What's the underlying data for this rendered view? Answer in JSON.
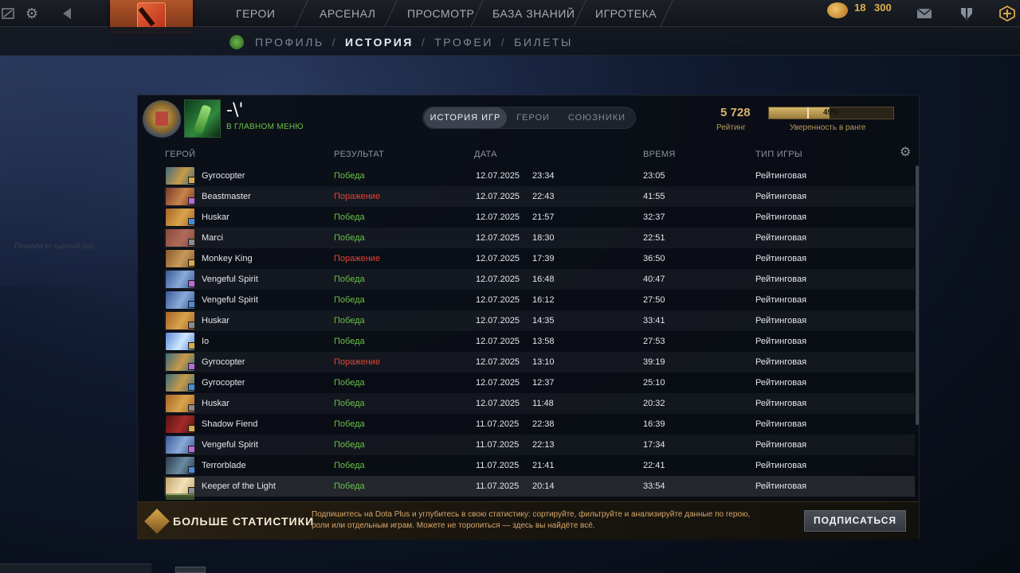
{
  "topbar": {
    "nav": [
      "ГЕРОИ",
      "АРСЕНАЛ",
      "ПРОСМОТР",
      "БАЗА ЗНАНИЙ",
      "ИГРОТЕКА"
    ],
    "currency_a": "18",
    "currency_b": "300"
  },
  "subnav": {
    "items": [
      "ПРОФИЛЬ",
      "ИСТОРИЯ",
      "ТРОФЕИ",
      "БИЛЕТЫ"
    ],
    "separator": "/",
    "active": "ИСТОРИЯ"
  },
  "profile": {
    "name": "-\\'",
    "status": "В ГЛАВНОМ МЕНЮ",
    "rating_value": "5 728",
    "rating_label": "Рейтинг",
    "confidence_value": 0.49,
    "confidence_text": "49%",
    "confidence_label": "Уверенность в ранге"
  },
  "tabs": [
    "ИСТОРИЯ ИГР",
    "ГЕРОИ",
    "СОЮЗНИКИ"
  ],
  "table": {
    "headers": [
      "ГЕРОЙ",
      "РЕЗУЛЬТАТ",
      "ДАТА",
      "ВРЕМЯ",
      "ТИП ИГРЫ"
    ],
    "rows": [
      {
        "hero": "Gyrocopter",
        "result": "Победа",
        "win": true,
        "date": "12.07.2025",
        "time": "23:34",
        "duration": "23:05",
        "type": "Рейтинговая"
      },
      {
        "hero": "Beastmaster",
        "result": "Поражение",
        "win": false,
        "date": "12.07.2025",
        "time": "22:43",
        "duration": "41:55",
        "type": "Рейтинговая"
      },
      {
        "hero": "Huskar",
        "result": "Победа",
        "win": true,
        "date": "12.07.2025",
        "time": "21:57",
        "duration": "32:37",
        "type": "Рейтинговая"
      },
      {
        "hero": "Marci",
        "result": "Победа",
        "win": true,
        "date": "12.07.2025",
        "time": "18:30",
        "duration": "22:51",
        "type": "Рейтинговая"
      },
      {
        "hero": "Monkey King",
        "result": "Поражение",
        "win": false,
        "date": "12.07.2025",
        "time": "17:39",
        "duration": "36:50",
        "type": "Рейтинговая"
      },
      {
        "hero": "Vengeful Spirit",
        "result": "Победа",
        "win": true,
        "date": "12.07.2025",
        "time": "16:48",
        "duration": "40:47",
        "type": "Рейтинговая"
      },
      {
        "hero": "Vengeful Spirit",
        "result": "Победа",
        "win": true,
        "date": "12.07.2025",
        "time": "16:12",
        "duration": "27:50",
        "type": "Рейтинговая"
      },
      {
        "hero": "Huskar",
        "result": "Победа",
        "win": true,
        "date": "12.07.2025",
        "time": "14:35",
        "duration": "33:41",
        "type": "Рейтинговая"
      },
      {
        "hero": "Io",
        "result": "Победа",
        "win": true,
        "date": "12.07.2025",
        "time": "13:58",
        "duration": "27:53",
        "type": "Рейтинговая"
      },
      {
        "hero": "Gyrocopter",
        "result": "Поражение",
        "win": false,
        "date": "12.07.2025",
        "time": "13:10",
        "duration": "39:19",
        "type": "Рейтинговая"
      },
      {
        "hero": "Gyrocopter",
        "result": "Победа",
        "win": true,
        "date": "12.07.2025",
        "time": "12:37",
        "duration": "25:10",
        "type": "Рейтинговая"
      },
      {
        "hero": "Huskar",
        "result": "Победа",
        "win": true,
        "date": "12.07.2025",
        "time": "11:48",
        "duration": "20:32",
        "type": "Рейтинговая"
      },
      {
        "hero": "Shadow Fiend",
        "result": "Победа",
        "win": true,
        "date": "11.07.2025",
        "time": "22:38",
        "duration": "16:39",
        "type": "Рейтинговая"
      },
      {
        "hero": "Vengeful Spirit",
        "result": "Победа",
        "win": true,
        "date": "11.07.2025",
        "time": "22:13",
        "duration": "17:34",
        "type": "Рейтинговая"
      },
      {
        "hero": "Terrorblade",
        "result": "Победа",
        "win": true,
        "date": "11.07.2025",
        "time": "21:41",
        "duration": "22:41",
        "type": "Рейтинговая"
      },
      {
        "hero": "Keeper of the Light",
        "result": "Победа",
        "win": true,
        "date": "11.07.2025",
        "time": "20:14",
        "duration": "33:54",
        "type": "Рейтинговая"
      }
    ]
  },
  "promo": {
    "title": "БОЛЬШЕ СТАТИСТИКИ",
    "text": "Подпишитесь на Dota Plus и углубитесь в свою статистику: сортируйте, фильтруйте и анализируйте данные по герою, роли или отдельным играм. Можете не торопиться — здесь вы найдёте всё.",
    "button": "ПОДПИСАТЬСЯ"
  },
  "side_ghost": "Похвала от сырный (lo)!",
  "colors": {
    "win": "#66c147",
    "loss": "#e0463a",
    "accent_gold": "#d8b46a",
    "status_green": "#6cc04a"
  },
  "icons": [
    "news-icon",
    "settings-gear-icon",
    "back-arrow-icon",
    "dota-logo-icon",
    "shards-coin-icon",
    "mail-icon",
    "armory-icon",
    "dota-plus-icon",
    "table-settings-gear-icon",
    "rank-medal-icon"
  ]
}
